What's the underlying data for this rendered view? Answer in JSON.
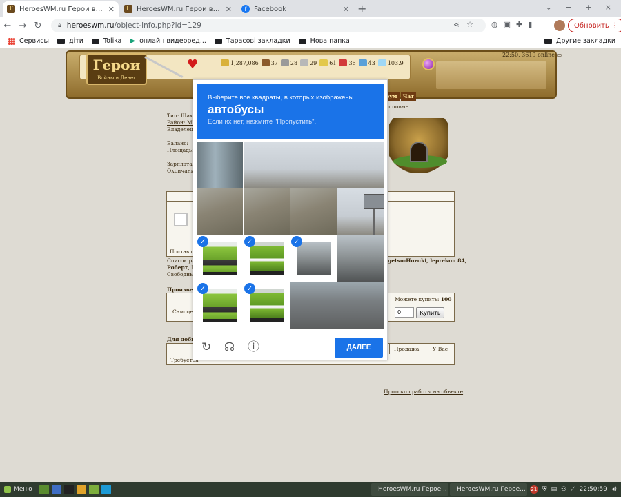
{
  "browser": {
    "tabs": [
      {
        "title": "HeroesWM.ru Герои войны и",
        "active": true
      },
      {
        "title": "HeroesWM.ru Герои войны и",
        "active": false
      },
      {
        "title": "Facebook",
        "active": false
      }
    ],
    "url_domain": "heroeswm.ru",
    "url_path": "/object-info.php?id=129",
    "update_button": "Обновить",
    "bookmarks": [
      "Сервисы",
      "діти",
      "Tolika",
      "онлайн видеоред...",
      "Тарасові закладки",
      "Нова папка"
    ],
    "other_bookmarks": "Другие закладки"
  },
  "game": {
    "online_status": "22:50, 3619 online",
    "resources": [
      {
        "value": "1,287,086",
        "color": "#d9b13a",
        "icon": "gold-icon"
      },
      {
        "value": "37",
        "color": "#8b5a2b",
        "icon": "wood-icon"
      },
      {
        "value": "28",
        "color": "#9a9a9a",
        "icon": "ore-icon"
      },
      {
        "value": "29",
        "color": "#b8b8b8",
        "icon": "mercury-icon"
      },
      {
        "value": "61",
        "color": "#e3c84a",
        "icon": "sulfur-icon"
      },
      {
        "value": "36",
        "color": "#d23a3a",
        "icon": "crystal-icon"
      },
      {
        "value": "43",
        "color": "#5aa0d8",
        "icon": "gem-icon"
      },
      {
        "value": "103.9",
        "color": "#9fd7f5",
        "icon": "diamond-icon"
      }
    ],
    "nav": [
      "рум",
      "Чат"
    ]
  },
  "object": {
    "info_lines": [
      "Тип: Шахт",
      "Район: Mi",
      "Владелец:",
      "",
      "Баланс:",
      "Площадь:",
      "",
      "Зарплата:",
      "Окончани"
    ],
    "type_tail": "пповые",
    "supply_label": "Поставл",
    "workers_line1": "Список ра",
    "workers_line1_tail": "getsu-Hozuki, leprekon 84,",
    "workers_line2": "Роберт, П",
    "free_line": "Свободны",
    "production_title": "Произвед",
    "can_buy_label": "Можете купить:",
    "can_buy_value": "100",
    "buy_quantity": "0",
    "buy_button": "Купить",
    "self_label": "Самоце",
    "mining_title": "Для добы",
    "table_headers": [
      "Продажа",
      "У Вас"
    ],
    "required_label": "Требуется",
    "protocol_link": "Протокол работы на объекте"
  },
  "captcha": {
    "instruction": "Выберите все квадраты, в которых изображены",
    "target": "автобусы",
    "hint": "Если их нет, нажмите \"Пропустить\".",
    "next_button": "ДАЛЕЕ",
    "tiles": [
      {
        "scene": "bldg",
        "selected": false
      },
      {
        "scene": "sky",
        "selected": false
      },
      {
        "scene": "sky",
        "selected": false
      },
      {
        "scene": "sky",
        "selected": false
      },
      {
        "scene": "tree",
        "selected": false
      },
      {
        "scene": "tree",
        "selected": false
      },
      {
        "scene": "tree",
        "selected": false
      },
      {
        "scene": "billboard",
        "selected": false
      },
      {
        "scene": "bus",
        "selected": true
      },
      {
        "scene": "bus2",
        "selected": true
      },
      {
        "scene": "street",
        "selected": true
      },
      {
        "scene": "street",
        "selected": false
      },
      {
        "scene": "bus",
        "selected": true
      },
      {
        "scene": "bus2",
        "selected": true
      },
      {
        "scene": "road",
        "selected": false
      },
      {
        "scene": "road",
        "selected": false
      }
    ]
  },
  "taskbar": {
    "menu": "Меню",
    "tasks": [
      "HeroesWM.ru Герое...",
      "HeroesWM.ru Герое..."
    ],
    "notification_count": "21",
    "clock": "22:50:59"
  }
}
